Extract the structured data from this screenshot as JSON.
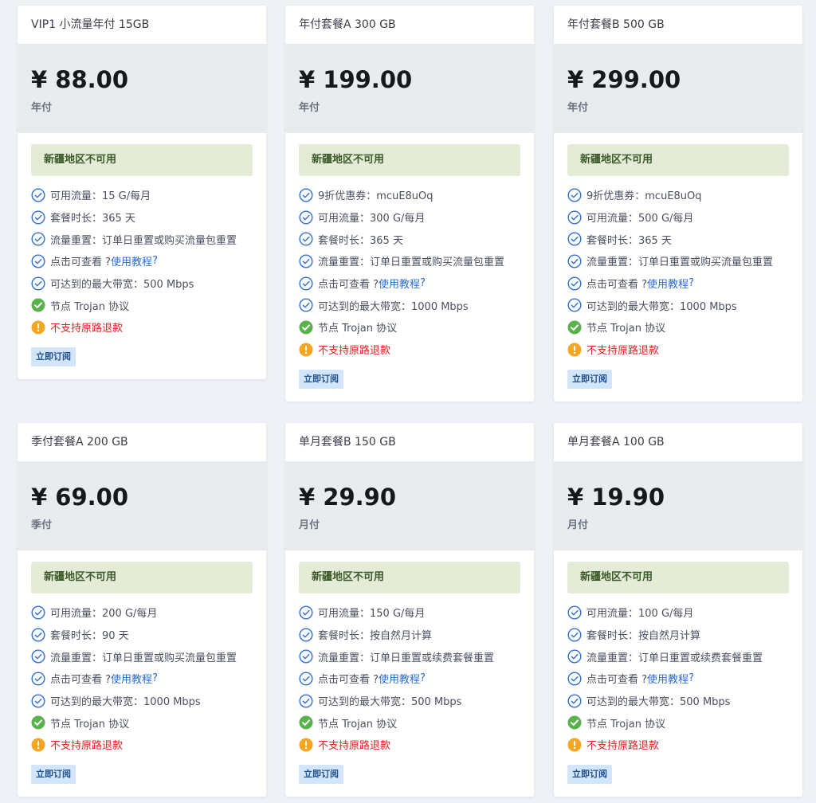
{
  "colors": {
    "page_bg": "#eef1f5",
    "notice_bg": "#e4ecd8",
    "check_outline": "#2f6fd1",
    "check_filled": "#5bb14d",
    "warning": "#f5a623",
    "warning_text": "#e02424",
    "button_bg": "#d3e5f9"
  },
  "plans": [
    {
      "title": "VIP1 小流量年付 15GB",
      "price": "¥ 88.00",
      "period": "年付",
      "notice": "新疆地区不可用",
      "features": [
        {
          "icon": "check-circle-outline-icon",
          "text": "可用流量：15 G/每月"
        },
        {
          "icon": "check-circle-outline-icon",
          "text": "套餐时长：365 天"
        },
        {
          "icon": "check-circle-outline-icon",
          "text": "流量重置：订单日重置或购买流量包重置"
        },
        {
          "icon": "check-circle-outline-icon",
          "text": "点击可查看 ?",
          "link": "使用教程",
          "suffix": "?"
        },
        {
          "icon": "check-circle-outline-icon",
          "text": "可达到的最大带宽：500 Mbps"
        },
        {
          "icon": "check-circle-filled-icon",
          "text": "节点 Trojan 协议"
        },
        {
          "icon": "warning-circle-icon",
          "text": "不支持原路退款",
          "warn": true
        }
      ],
      "button": "立即订阅"
    },
    {
      "title": "年付套餐A 300 GB",
      "price": "¥ 199.00",
      "period": "年付",
      "notice": "新疆地区不可用",
      "features": [
        {
          "icon": "check-circle-outline-icon",
          "text": "9折优惠券：mcuE8uOq"
        },
        {
          "icon": "check-circle-outline-icon",
          "text": "可用流量：300 G/每月"
        },
        {
          "icon": "check-circle-outline-icon",
          "text": "套餐时长：365 天"
        },
        {
          "icon": "check-circle-outline-icon",
          "text": "流量重置：订单日重置或购买流量包重置"
        },
        {
          "icon": "check-circle-outline-icon",
          "text": "点击可查看 ?",
          "link": "使用教程",
          "suffix": "?"
        },
        {
          "icon": "check-circle-outline-icon",
          "text": "可达到的最大带宽：1000 Mbps"
        },
        {
          "icon": "check-circle-filled-icon",
          "text": "节点 Trojan 协议"
        },
        {
          "icon": "warning-circle-icon",
          "text": "不支持原路退款",
          "warn": true
        }
      ],
      "button": "立即订阅"
    },
    {
      "title": "年付套餐B 500 GB",
      "price": "¥ 299.00",
      "period": "年付",
      "notice": "新疆地区不可用",
      "features": [
        {
          "icon": "check-circle-outline-icon",
          "text": "9折优惠券：mcuE8uOq"
        },
        {
          "icon": "check-circle-outline-icon",
          "text": "可用流量：500 G/每月"
        },
        {
          "icon": "check-circle-outline-icon",
          "text": "套餐时长：365 天"
        },
        {
          "icon": "check-circle-outline-icon",
          "text": "流量重置：订单日重置或购买流量包重置"
        },
        {
          "icon": "check-circle-outline-icon",
          "text": "点击可查看 ?",
          "link": "使用教程",
          "suffix": "?"
        },
        {
          "icon": "check-circle-outline-icon",
          "text": "可达到的最大带宽：1000 Mbps"
        },
        {
          "icon": "check-circle-filled-icon",
          "text": "节点 Trojan 协议"
        },
        {
          "icon": "warning-circle-icon",
          "text": "不支持原路退款",
          "warn": true
        }
      ],
      "button": "立即订阅"
    },
    {
      "title": "季付套餐A 200 GB",
      "price": "¥ 69.00",
      "period": "季付",
      "notice": "新疆地区不可用",
      "features": [
        {
          "icon": "check-circle-outline-icon",
          "text": "可用流量：200 G/每月"
        },
        {
          "icon": "check-circle-outline-icon",
          "text": "套餐时长：90 天"
        },
        {
          "icon": "check-circle-outline-icon",
          "text": "流量重置：订单日重置或购买流量包重置"
        },
        {
          "icon": "check-circle-outline-icon",
          "text": "点击可查看 ?",
          "link": "使用教程",
          "suffix": "?"
        },
        {
          "icon": "check-circle-outline-icon",
          "text": "可达到的最大带宽：1000 Mbps"
        },
        {
          "icon": "check-circle-filled-icon",
          "text": "节点 Trojan 协议"
        },
        {
          "icon": "warning-circle-icon",
          "text": "不支持原路退款",
          "warn": true
        }
      ],
      "button": "立即订阅"
    },
    {
      "title": "单月套餐B 150 GB",
      "price": "¥ 29.90",
      "period": "月付",
      "notice": "新疆地区不可用",
      "features": [
        {
          "icon": "check-circle-outline-icon",
          "text": "可用流量：150 G/每月"
        },
        {
          "icon": "check-circle-outline-icon",
          "text": "套餐时长：按自然月计算"
        },
        {
          "icon": "check-circle-outline-icon",
          "text": "流量重置：订单日重置或续费套餐重置"
        },
        {
          "icon": "check-circle-outline-icon",
          "text": "点击可查看 ?",
          "link": "使用教程",
          "suffix": "?"
        },
        {
          "icon": "check-circle-outline-icon",
          "text": "可达到的最大带宽：500 Mbps"
        },
        {
          "icon": "check-circle-filled-icon",
          "text": "节点 Trojan 协议"
        },
        {
          "icon": "warning-circle-icon",
          "text": "不支持原路退款",
          "warn": true
        }
      ],
      "button": "立即订阅"
    },
    {
      "title": "单月套餐A 100 GB",
      "price": "¥ 19.90",
      "period": "月付",
      "notice": "新疆地区不可用",
      "features": [
        {
          "icon": "check-circle-outline-icon",
          "text": "可用流量：100 G/每月"
        },
        {
          "icon": "check-circle-outline-icon",
          "text": "套餐时长：按自然月计算"
        },
        {
          "icon": "check-circle-outline-icon",
          "text": "流量重置：订单日重置或续费套餐重置"
        },
        {
          "icon": "check-circle-outline-icon",
          "text": "点击可查看 ?",
          "link": "使用教程",
          "suffix": "?"
        },
        {
          "icon": "check-circle-outline-icon",
          "text": "可达到的最大带宽：500 Mbps"
        },
        {
          "icon": "check-circle-filled-icon",
          "text": "节点 Trojan 协议"
        },
        {
          "icon": "warning-circle-icon",
          "text": "不支持原路退款",
          "warn": true
        }
      ],
      "button": "立即订阅"
    }
  ]
}
